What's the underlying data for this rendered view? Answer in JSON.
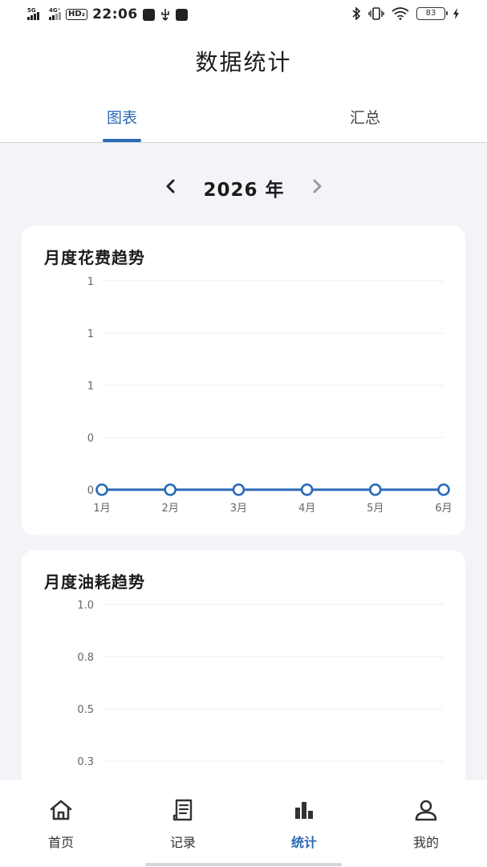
{
  "status_bar": {
    "signal_1_tag": "5G",
    "signal_2_tag": "4G⁺",
    "hd_badge": "HD₂",
    "time": "22:06",
    "battery_level": "83",
    "icons": [
      "signal-icon",
      "hd-voice-icon",
      "vpn-icon",
      "usb-icon",
      "message-icon",
      "bluetooth-icon",
      "vibrate-icon",
      "wifi-icon",
      "battery-icon",
      "charging-icon"
    ]
  },
  "page": {
    "title": "数据统计"
  },
  "tabs": [
    {
      "label": "图表",
      "active": true
    },
    {
      "label": "汇总",
      "active": false
    }
  ],
  "year_selector": {
    "label": "2026 年",
    "prev_icon": "chevron-left-icon",
    "next_icon": "chevron-right-icon"
  },
  "chart_data": [
    {
      "type": "line",
      "title": "月度花费趋势",
      "categories": [
        "1月",
        "2月",
        "3月",
        "4月",
        "5月",
        "6月"
      ],
      "values": [
        0,
        0,
        0,
        0,
        0,
        0
      ],
      "y_tick_labels": [
        "1",
        "1",
        "1",
        "0",
        "0"
      ],
      "ylim": [
        0,
        1
      ],
      "grid": true,
      "color": "#2a6ab5"
    },
    {
      "type": "line",
      "title": "月度油耗趋势",
      "y_tick_labels": [
        "1.0",
        "0.8",
        "0.5",
        "0.3"
      ],
      "ylim": [
        0,
        1
      ],
      "grid": true
    }
  ],
  "bottom_nav": [
    {
      "label": "首页",
      "icon": "home-icon",
      "active": false
    },
    {
      "label": "记录",
      "icon": "receipt-icon",
      "active": false
    },
    {
      "label": "统计",
      "icon": "bar-chart-icon",
      "active": true
    },
    {
      "label": "我的",
      "icon": "user-icon",
      "active": false
    }
  ],
  "colors": {
    "accent": "#2a6ab5",
    "background": "#f3f4f8",
    "card": "#ffffff"
  }
}
